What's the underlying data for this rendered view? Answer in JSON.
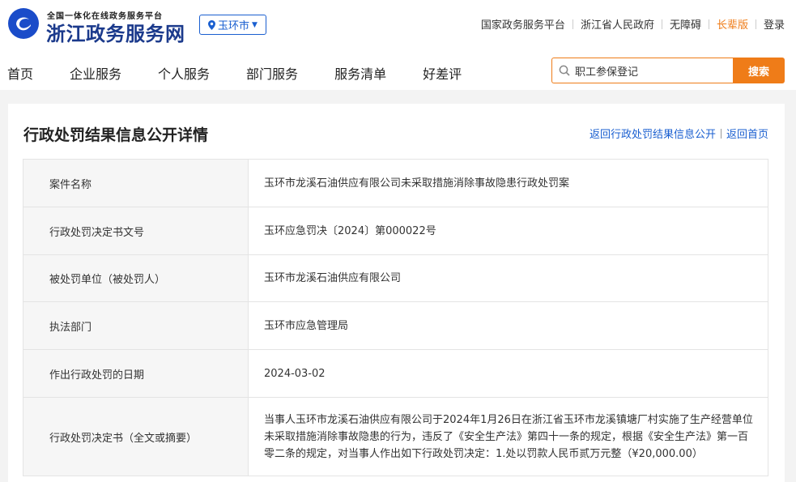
{
  "header": {
    "logo_small": "全国一体化在线政务服务平台",
    "logo_big": "浙江政务服务网",
    "city": "玉环市",
    "top_links": [
      "国家政务服务平台",
      "浙江省人民政府",
      "无障碍",
      "长辈版",
      "登录"
    ]
  },
  "nav": {
    "items": [
      "首页",
      "企业服务",
      "个人服务",
      "部门服务",
      "服务清单",
      "好差评"
    ]
  },
  "search": {
    "value": "职工参保登记",
    "button": "搜索"
  },
  "detail": {
    "title": "行政处罚结果信息公开详情",
    "back_links": [
      "返回行政处罚结果信息公开",
      "返回首页"
    ],
    "rows": [
      {
        "label": "案件名称",
        "value": "玉环市龙溪石油供应有限公司未采取措施消除事故隐患行政处罚案"
      },
      {
        "label": "行政处罚决定书文号",
        "value": "玉环应急罚决〔2024〕第000022号"
      },
      {
        "label": "被处罚单位（被处罚人）",
        "value": "玉环市龙溪石油供应有限公司"
      },
      {
        "label": "执法部门",
        "value": "玉环市应急管理局"
      },
      {
        "label": "作出行政处罚的日期",
        "value": "2024-03-02"
      },
      {
        "label": "行政处罚决定书（全文或摘要）",
        "value": "当事人玉环市龙溪石油供应有限公司于2024年1月26日在浙江省玉环市龙溪镇塘厂村实施了生产经营单位未采取措施消除事故隐患的行为，违反了《安全生产法》第四十一条的规定，根据《安全生产法》第一百零二条的规定，对当事人作出如下行政处罚决定：1.处以罚款人民币贰万元整（¥20,000.00）"
      }
    ]
  },
  "colors": {
    "brand_blue": "#1a5fd0",
    "accent_orange": "#ef7c18"
  }
}
